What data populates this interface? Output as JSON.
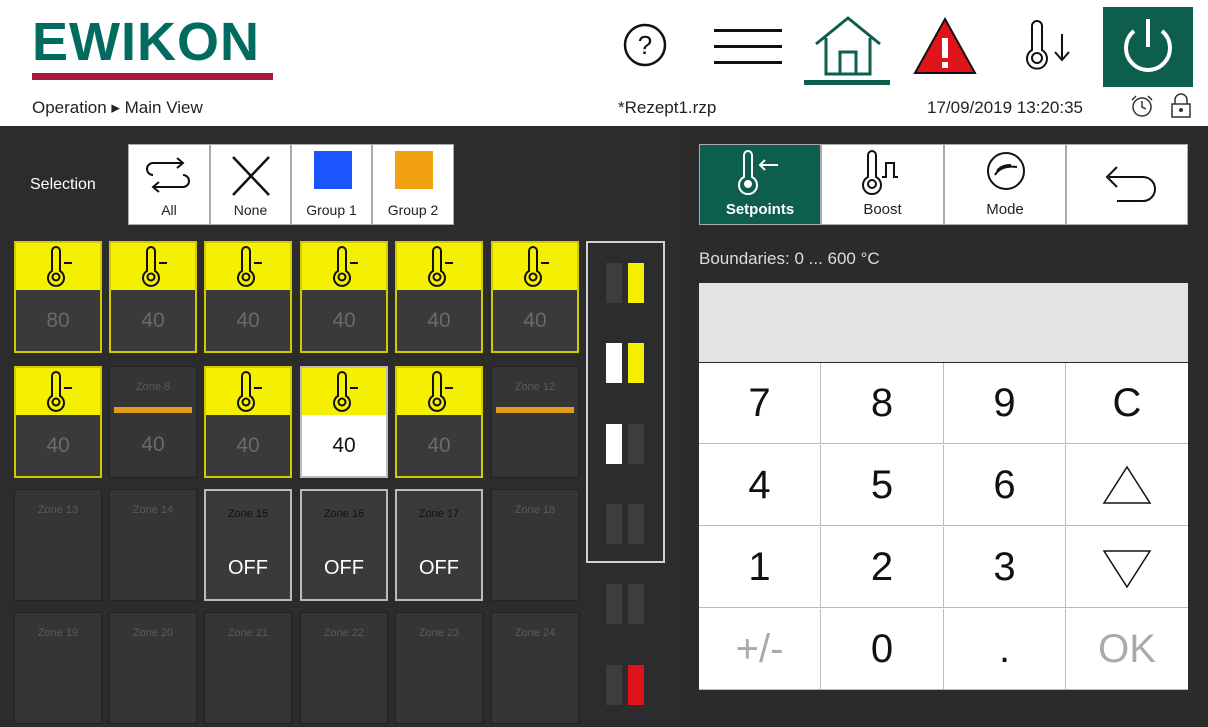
{
  "header": {
    "logo": "EWIKON",
    "breadcrumb": "Operation ▸ Main View",
    "filename": "*Rezept1.rzp",
    "datetime": "17/09/2019 13:20:35",
    "help_glyph": "?",
    "icons": [
      "help-icon",
      "menu-icon",
      "home-icon",
      "warning-icon",
      "thermometer-down-icon",
      "power-icon",
      "alarm-clock-icon",
      "lock-icon"
    ]
  },
  "selection": {
    "label": "Selection",
    "buttons": [
      {
        "label": "All",
        "icon": "select-all-icon"
      },
      {
        "label": "None",
        "icon": "x-icon"
      },
      {
        "label": "Group 1",
        "color": "#1a55ff"
      },
      {
        "label": "Group 2",
        "color": "#f0a010"
      }
    ]
  },
  "zones": {
    "row1": [
      "80",
      "40",
      "40",
      "40",
      "40",
      "40"
    ],
    "row2": [
      "40",
      "40",
      "40",
      "40",
      "40",
      ""
    ],
    "row2_names": {
      "z8": "Zone 8",
      "z12": "Zone 12"
    },
    "row3_names": [
      "Zone 13",
      "Zone 14",
      "Zone 15",
      "Zone 16",
      "Zone 17",
      "Zone 18"
    ],
    "row3_vals": [
      "OFF",
      "OFF",
      "OFF"
    ],
    "row4_names": [
      "Zone 19",
      "Zone 20",
      "Zone 21",
      "Zone 22",
      "Zone 23",
      "Zone 24"
    ]
  },
  "tabs": [
    {
      "label": "Setpoints",
      "icon": "thermometer-setpoint-icon"
    },
    {
      "label": "Boost",
      "icon": "thermometer-boost-icon"
    },
    {
      "label": "Mode",
      "icon": "mode-hand-icon"
    },
    {
      "label": "",
      "icon": "back-arrow-icon"
    }
  ],
  "boundaries": "Boundaries: 0 ... 600 °C",
  "keypad": {
    "keys": [
      "7",
      "8",
      "9",
      "C",
      "4",
      "5",
      "6",
      "",
      "1",
      "2",
      "3",
      "",
      "+/-",
      "0",
      ".",
      "OK"
    ],
    "disabled": [
      "+/-",
      "OK"
    ]
  },
  "colors": {
    "brand_green": "#0e5e4e",
    "brand_red": "#a8193d",
    "zone_yellow": "#f5ef00",
    "group1": "#1a55ff",
    "group2": "#f0a010",
    "alarm_red": "#e0121a"
  }
}
